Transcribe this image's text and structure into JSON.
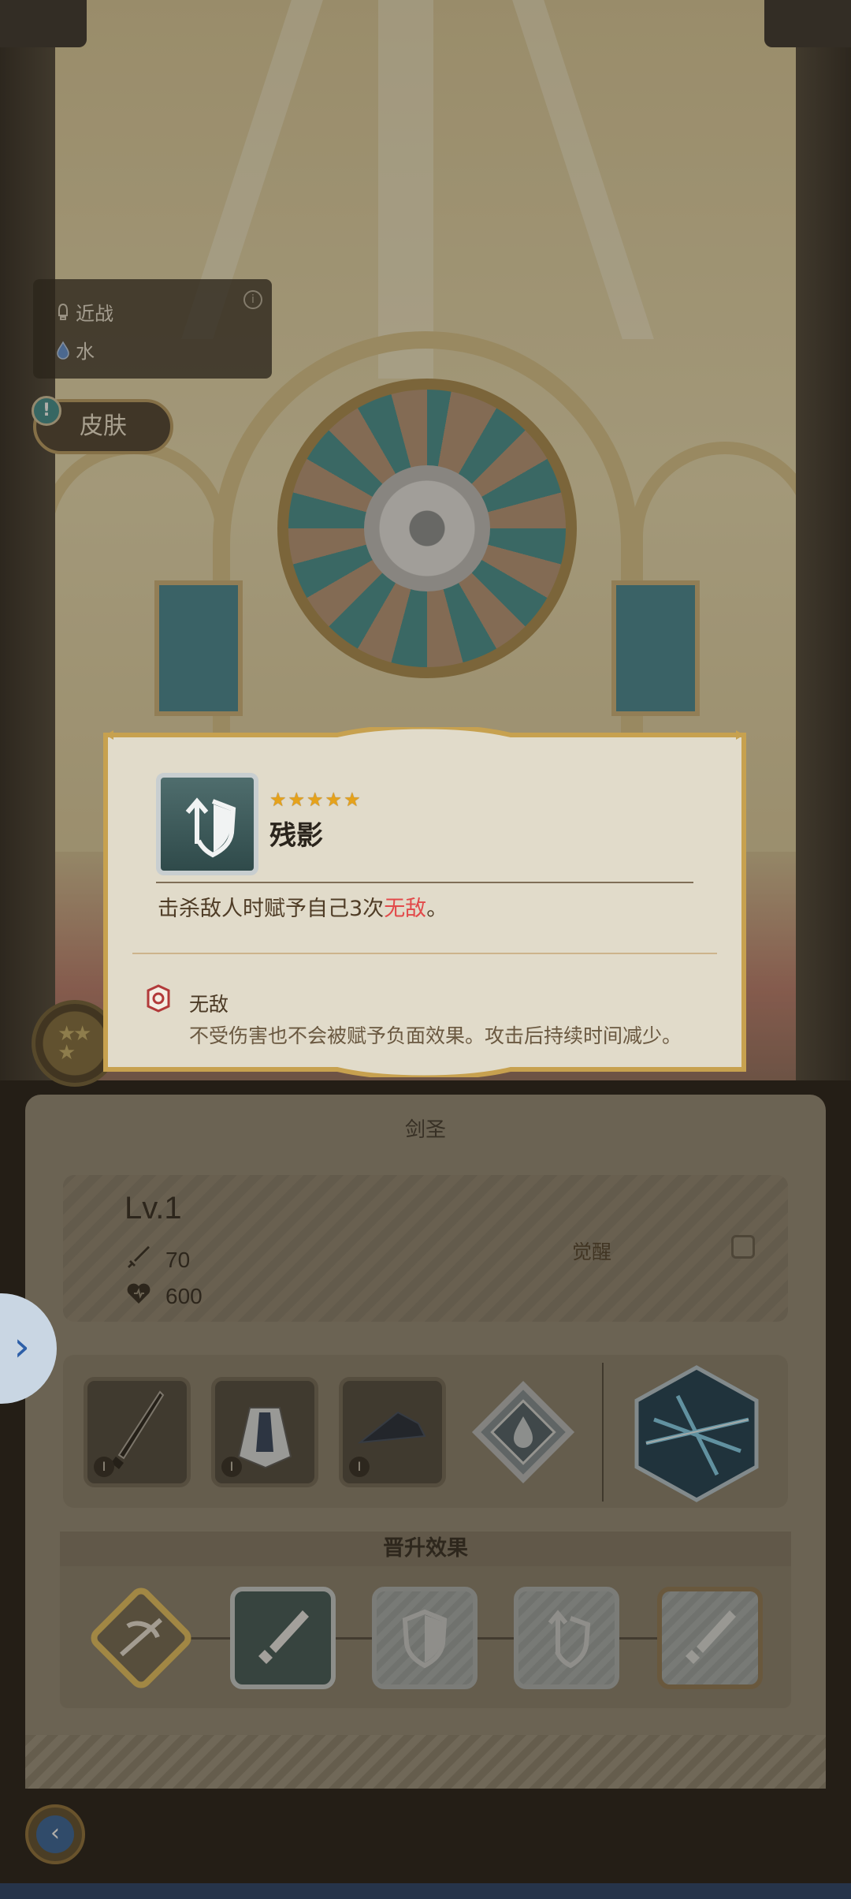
{
  "info": {
    "attack_type": "近战",
    "element": "水",
    "info_icon": "info-icon"
  },
  "skin_button": {
    "label": "皮肤",
    "badge": "!"
  },
  "hero": {
    "class_name": "剑圣"
  },
  "stats": {
    "level": "Lv.1",
    "attack": "70",
    "hp": "600",
    "awaken_label": "觉醒",
    "awaken_checked": false
  },
  "equipment": {
    "slots": [
      {
        "icon": "sword-icon",
        "tier": "I"
      },
      {
        "icon": "cape-armor-icon",
        "tier": "I"
      },
      {
        "icon": "straw-hat-icon",
        "tier": "I"
      },
      {
        "icon": "water-rune-icon",
        "tier": ""
      }
    ],
    "skill_icon": "lightning-slash-icon"
  },
  "promotion": {
    "title": "晋升效果",
    "nodes": [
      {
        "icon": "bow-icon",
        "state": "unlocked"
      },
      {
        "icon": "dagger-icon",
        "state": "unlocked"
      },
      {
        "icon": "shield-icon",
        "state": "locked"
      },
      {
        "icon": "shield-arrow-icon",
        "state": "locked"
      },
      {
        "icon": "dagger-icon",
        "state": "locked"
      }
    ]
  },
  "popup": {
    "skill_name": "残影",
    "stars": 5,
    "desc_prefix": "击杀敌人时赋予自己3次",
    "desc_highlight": "无敌",
    "desc_suffix": "。",
    "status_name": "无敌",
    "status_desc": "不受伤害也不会被赋予负面效果。攻击后持续时间减少。",
    "highlight_color": "#e24a4a"
  },
  "navigation": {
    "back_icon": "back-arrow-icon",
    "side_icon": "chevron-right-icon"
  }
}
